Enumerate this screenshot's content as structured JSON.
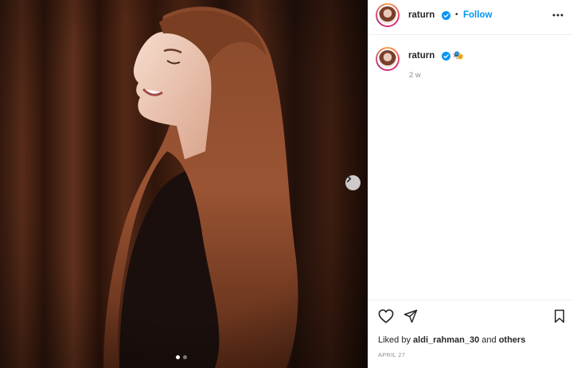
{
  "post": {
    "username": "raturn",
    "follow_label": "Follow",
    "separator": "•",
    "caption_emoji": "🎭",
    "time_ago": "2 w",
    "liked_prefix": "Liked by",
    "liked_user": "aldi_rahman_30",
    "liked_and": "and",
    "liked_others": "others",
    "date": "APRIL 27",
    "carousel": {
      "total_slides": 2,
      "current_slide": 1
    }
  },
  "colors": {
    "link_blue": "#0095f6",
    "verified_blue": "#0095f6",
    "text": "#262626",
    "muted": "#8e8e8e",
    "divider": "#efefef"
  },
  "icons": {
    "next": "chevron-right-icon",
    "more": "more-horizontal-icon",
    "like": "heart-icon",
    "share": "paper-plane-icon",
    "save": "bookmark-icon",
    "verified": "verified-badge-icon"
  }
}
